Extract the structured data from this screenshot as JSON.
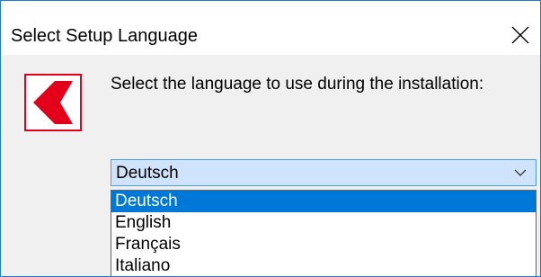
{
  "window": {
    "title": "Select Setup Language"
  },
  "main": {
    "prompt": "Select the language to use during the installation:",
    "logo_icon": "red-chevron-logo",
    "logo_color": "#e2001a"
  },
  "language_select": {
    "selected_value": "Deutsch",
    "options": [
      "Deutsch",
      "English",
      "Français",
      "Italiano"
    ],
    "highlight_color": "#0078d7"
  }
}
